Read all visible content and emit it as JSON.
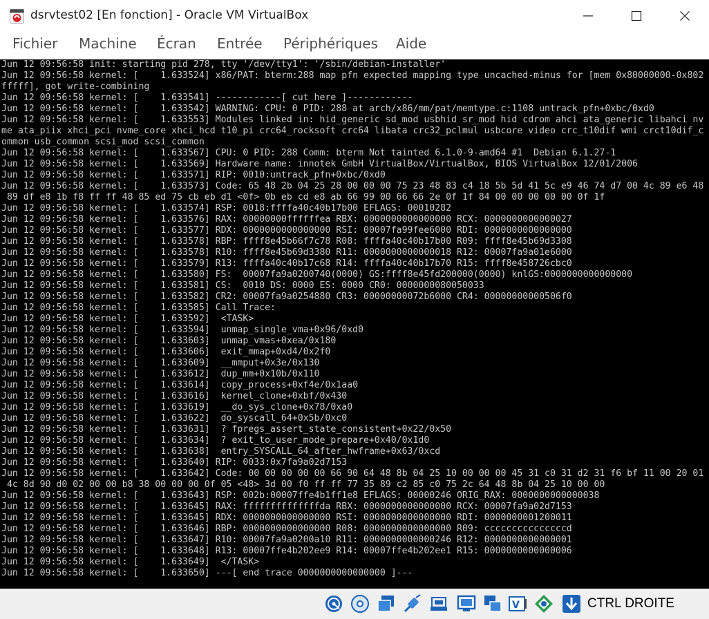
{
  "window": {
    "title": "dsrvtest02 [En fonction] - Oracle VM VirtualBox"
  },
  "menu": {
    "items": [
      "Fichier",
      "Machine",
      "Écran",
      "Entrée",
      "Périphériques",
      "Aide"
    ]
  },
  "console": {
    "lines": [
      "Jun 12 09:56:58 init: starting pid 278, tty '/dev/tty1': '/sbin/debian-installer'",
      "Jun 12 09:56:58 kernel: [    1.633524] x86/PAT: bterm:288 map pfn expected mapping type uncached-minus for [mem 0x80000000-0x802",
      "fffff], got write-combining",
      "Jun 12 09:56:58 kernel: [    1.633541] ------------[ cut here ]------------",
      "Jun 12 09:56:58 kernel: [    1.633542] WARNING: CPU: 0 PID: 288 at arch/x86/mm/pat/memtype.c:1108 untrack_pfn+0xbc/0xd0",
      "Jun 12 09:56:58 kernel: [    1.633553] Modules linked in: hid_generic sd_mod usbhid sr_mod hid cdrom ahci ata_generic libahci nv",
      "me ata_piix xhci_pci nvme_core xhci_hcd t10_pi crc64_rocksoft crc64 libata crc32_pclmul usbcore video crc_t10dif wmi crct10dif_c",
      "ommon usb_common scsi_mod scsi_common",
      "Jun 12 09:56:58 kernel: [    1.633567] CPU: 0 PID: 288 Comm: bterm Not tainted 6.1.0-9-amd64 #1  Debian 6.1.27-1",
      "Jun 12 09:56:58 kernel: [    1.633569] Hardware name: innotek GmbH VirtualBox/VirtualBox, BIOS VirtualBox 12/01/2006",
      "Jun 12 09:56:58 kernel: [    1.633571] RIP: 0010:untrack_pfn+0xbc/0xd0",
      "Jun 12 09:56:58 kernel: [    1.633573] Code: 65 48 2b 04 25 28 00 00 00 75 23 48 83 c4 18 5b 5d 41 5c e9 46 74 d7 00 4c 89 e6 48",
      " 89 df e8 1b f8 ff ff 48 85 ed 75 cb eb d1 <0f> 0b eb cd e8 ab 66 99 00 66 66 2e 0f 1f 84 00 00 00 00 00 0f 1f",
      "Jun 12 09:56:58 kernel: [    1.633574] RSP: 0018:ffffa40c40b17b00 EFLAGS: 00010282",
      "Jun 12 09:56:58 kernel: [    1.633576] RAX: 00000000ffffffea RBX: 0000000000000000 RCX: 0000000000000027",
      "Jun 12 09:56:58 kernel: [    1.633577] RDX: 0000000000000000 RSI: 00007fa99fee6000 RDI: 0000000000000000",
      "Jun 12 09:56:58 kernel: [    1.633578] RBP: ffff8e45b66f7c78 R08: ffffa40c40b17b00 R09: ffff8e45b69d3308",
      "Jun 12 09:56:58 kernel: [    1.633578] R10: ffff8e45b69d3380 R11: 0000000000000018 R12: 00007fa9a01e6000",
      "Jun 12 09:56:58 kernel: [    1.633579] R13: ffffa40c40b17c68 R14: ffffa40c40b17b70 R15: ffff8e458726cbc0",
      "Jun 12 09:56:58 kernel: [    1.633580] FS:  00007fa9a0200740(0000) GS:ffff8e45fd200000(0000) knlGS:0000000000000000",
      "Jun 12 09:56:58 kernel: [    1.633581] CS:  0010 DS: 0000 ES: 0000 CR0: 0000000080050033",
      "Jun 12 09:56:58 kernel: [    1.633582] CR2: 00007fa9a0254880 CR3: 00000000072b6000 CR4: 00000000000506f0",
      "Jun 12 09:56:58 kernel: [    1.633585] Call Trace:",
      "Jun 12 09:56:58 kernel: [    1.633592]  <TASK>",
      "Jun 12 09:56:58 kernel: [    1.633594]  unmap_single_vma+0x96/0xd0",
      "Jun 12 09:56:58 kernel: [    1.633603]  unmap_vmas+0xea/0x180",
      "Jun 12 09:56:58 kernel: [    1.633606]  exit_mmap+0xd4/0x2f0",
      "Jun 12 09:56:58 kernel: [    1.633609]  __mmput+0x3e/0x130",
      "Jun 12 09:56:58 kernel: [    1.633612]  dup_mm+0x10b/0x110",
      "Jun 12 09:56:58 kernel: [    1.633614]  copy_process+0xf4e/0x1aa0",
      "Jun 12 09:56:58 kernel: [    1.633616]  kernel_clone+0xbf/0x430",
      "Jun 12 09:56:58 kernel: [    1.633619]  __do_sys_clone+0x78/0xa0",
      "Jun 12 09:56:58 kernel: [    1.633622]  do_syscall_64+0x5b/0xc0",
      "Jun 12 09:56:58 kernel: [    1.633631]  ? fpregs_assert_state_consistent+0x22/0x50",
      "Jun 12 09:56:58 kernel: [    1.633634]  ? exit_to_user_mode_prepare+0x40/0x1d0",
      "Jun 12 09:56:58 kernel: [    1.633638]  entry_SYSCALL_64_after_hwframe+0x63/0xcd",
      "Jun 12 09:56:58 kernel: [    1.633640] RIP: 0033:0x7fa9a02d7153",
      "Jun 12 09:56:58 kernel: [    1.633642] Code: 00 00 00 00 00 66 90 64 48 8b 04 25 10 00 00 00 45 31 c0 31 d2 31 f6 bf 11 00 20 01",
      " 4c 8d 90 d0 02 00 00 b8 38 00 00 00 0f 05 <48> 3d 00 f0 ff ff 77 35 89 c2 85 c0 75 2c 64 48 8b 04 25 10 00 00",
      "Jun 12 09:56:58 kernel: [    1.633643] RSP: 002b:00007ffe4b1ff1e8 EFLAGS: 00000246 ORIG_RAX: 0000000000000038",
      "Jun 12 09:56:58 kernel: [    1.633645] RAX: ffffffffffffffda RBX: 0000000000000000 RCX: 00007fa9a02d7153",
      "Jun 12 09:56:58 kernel: [    1.633645] RDX: 0000000000000000 RSI: 0000000000000000 RDI: 0000000001200011",
      "Jun 12 09:56:58 kernel: [    1.633646] RBP: 0000000000000000 R08: 0000000000000000 R09: cccccccccccccccd",
      "Jun 12 09:56:58 kernel: [    1.633647] R10: 00007fa9a0200a10 R11: 0000000000000246 R12: 0000000000000001",
      "Jun 12 09:56:58 kernel: [    1.633648] R13: 00007ffe4b202ee9 R14: 00007ffe4b202ee1 R15: 0000000000000006",
      "Jun 12 09:56:58 kernel: [    1.633649]  </TASK>",
      "Jun 12 09:56:58 kernel: [    1.633650] ---[ end trace 0000000000000000 ]---"
    ]
  },
  "statusbar": {
    "icons": [
      "hard-disk-icon",
      "optical-drive-icon",
      "audio-icon",
      "network-icon",
      "usb-icon",
      "shared-folders-icon",
      "display-icon",
      "video-capture-icon",
      "recording-icon",
      "virtualization-icon",
      "mouse-integration-icon",
      "keyboard-capture-icon"
    ],
    "host_key": "CTRL DROITE"
  },
  "colors": {
    "console_bg": "#000000",
    "console_fg": "#c8c8c8",
    "menu_fg": "#505050",
    "statusbar_bg": "#f0f0f0",
    "accent_blue": "#1c63b8"
  }
}
